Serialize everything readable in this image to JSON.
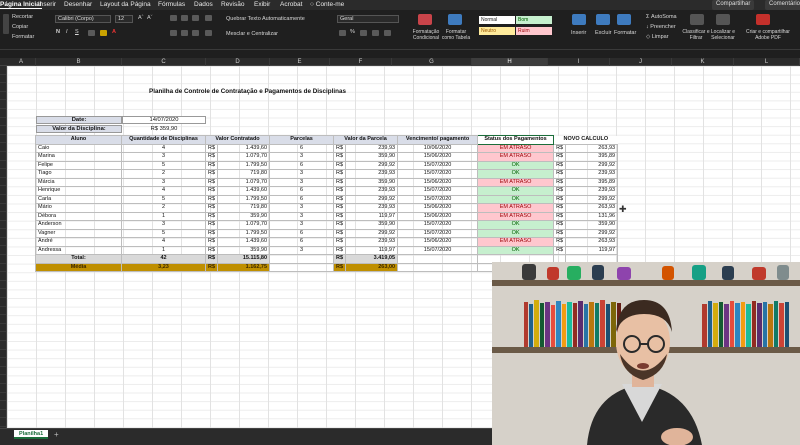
{
  "menu": {
    "tabs": [
      "Página Inicial",
      "Inserir",
      "Desenhar",
      "Layout da Página",
      "Fórmulas",
      "Dados",
      "Revisão",
      "Exibir",
      "Acrobat",
      "Conte-me"
    ],
    "share": "Compartilhar",
    "comments": "Comentários"
  },
  "ribbon": {
    "clipboard": [
      "Recortar",
      "Copiar",
      "Formatar"
    ],
    "font_name": "Calibri (Corpo)",
    "font_size": "12",
    "wrap_text": "Quebrar Texto Automaticamente",
    "merge_center": "Mesclar e Centralizar",
    "number_format": "Geral",
    "conditional_formatting": "Formatação Condicional",
    "format_as_table": "Formatar como Tabela",
    "styles": [
      {
        "label": "Normal",
        "color": "#ffffff"
      },
      {
        "label": "Bom",
        "color": "#c6efce"
      },
      {
        "label": "Neutro",
        "color": "#ffeb9c"
      },
      {
        "label": "Ruim",
        "color": "#ffc7ce"
      }
    ],
    "cells": [
      "Inserir",
      "Excluir",
      "Formatar"
    ],
    "editing": [
      "AutoSoma",
      "Preencher",
      "Limpar"
    ],
    "sort_filter": "Classificar e Filtrar",
    "find_select": "Localizar e Selecionar",
    "share_pdf": "Criar e compartilhar Adobe PDF"
  },
  "columns": [
    "A",
    "B",
    "C",
    "D",
    "E",
    "F",
    "G",
    "H",
    "I",
    "J",
    "K",
    "L"
  ],
  "sheet": {
    "title": "Planilha de Controle de Contratação e Pagamentos de Disciplinas",
    "date_label": "Date:",
    "date_value": "14/07/2020",
    "price_label": "Valor da Disciplina:",
    "price_value": "R$ 359,90",
    "headers": [
      "Aluno",
      "Quantidade de Disciplinas",
      "Valor Contratado",
      "Parcelas",
      "Valor da Parcela",
      "Vencimento/ pagamento",
      "Status dos Pagamentos",
      "NOVO CÁLCULO"
    ],
    "currency": "R$",
    "rows": [
      {
        "aluno": "Caio",
        "qtd": "4",
        "valor": "1.439,60",
        "parcelas": "6",
        "parcela": "239,93",
        "venc": "10/06/2020",
        "status": "EM ATRASO",
        "novo": "263,93"
      },
      {
        "aluno": "Marina",
        "qtd": "3",
        "valor": "1.079,70",
        "parcelas": "3",
        "parcela": "359,90",
        "venc": "15/06/2020",
        "status": "EM ATRASO",
        "novo": "395,89"
      },
      {
        "aluno": "Felipe",
        "qtd": "5",
        "valor": "1.799,50",
        "parcelas": "6",
        "parcela": "299,92",
        "venc": "15/07/2020",
        "status": "OK",
        "novo": "299,92"
      },
      {
        "aluno": "Tiago",
        "qtd": "2",
        "valor": "719,80",
        "parcelas": "3",
        "parcela": "239,93",
        "venc": "15/07/2020",
        "status": "OK",
        "novo": "239,93"
      },
      {
        "aluno": "Márcia",
        "qtd": "3",
        "valor": "1.079,70",
        "parcelas": "3",
        "parcela": "359,90",
        "venc": "15/06/2020",
        "status": "EM ATRASO",
        "novo": "395,89"
      },
      {
        "aluno": "Henrique",
        "qtd": "4",
        "valor": "1.439,60",
        "parcelas": "6",
        "parcela": "239,93",
        "venc": "15/07/2020",
        "status": "OK",
        "novo": "239,93"
      },
      {
        "aluno": "Carla",
        "qtd": "5",
        "valor": "1.799,50",
        "parcelas": "6",
        "parcela": "299,92",
        "venc": "15/07/2020",
        "status": "OK",
        "novo": "299,92"
      },
      {
        "aluno": "Mário",
        "qtd": "2",
        "valor": "719,80",
        "parcelas": "3",
        "parcela": "239,93",
        "venc": "15/06/2020",
        "status": "EM ATRASO",
        "novo": "263,93"
      },
      {
        "aluno": "Débora",
        "qtd": "1",
        "valor": "359,90",
        "parcelas": "3",
        "parcela": "119,97",
        "venc": "15/06/2020",
        "status": "EM ATRASO",
        "novo": "131,96"
      },
      {
        "aluno": "Anderson",
        "qtd": "3",
        "valor": "1.079,70",
        "parcelas": "3",
        "parcela": "359,90",
        "venc": "15/07/2020",
        "status": "OK",
        "novo": "359,90"
      },
      {
        "aluno": "Vagner",
        "qtd": "5",
        "valor": "1.799,50",
        "parcelas": "6",
        "parcela": "299,92",
        "venc": "15/07/2020",
        "status": "OK",
        "novo": "299,92"
      },
      {
        "aluno": "André",
        "qtd": "4",
        "valor": "1.439,60",
        "parcelas": "6",
        "parcela": "239,93",
        "venc": "15/06/2020",
        "status": "EM ATRASO",
        "novo": "263,93"
      },
      {
        "aluno": "Andressa",
        "qtd": "1",
        "valor": "359,90",
        "parcelas": "3",
        "parcela": "119,97",
        "venc": "15/07/2020",
        "status": "OK",
        "novo": "119,97"
      }
    ],
    "total_label": "Total:",
    "total_qtd": "42",
    "total_valor": "15.115,80",
    "total_parcela": "3.419,05",
    "media_label": "Média",
    "media_qtd": "3,23",
    "media_valor": "1.162,75",
    "media_parcela": "263,00"
  },
  "sheet_tab": "Planilha1",
  "colors": {
    "ok_bg": "#c6efce",
    "late_bg": "#ffc7ce",
    "header_bg": "#d9dde8",
    "media_bg": "#bf8f00"
  }
}
